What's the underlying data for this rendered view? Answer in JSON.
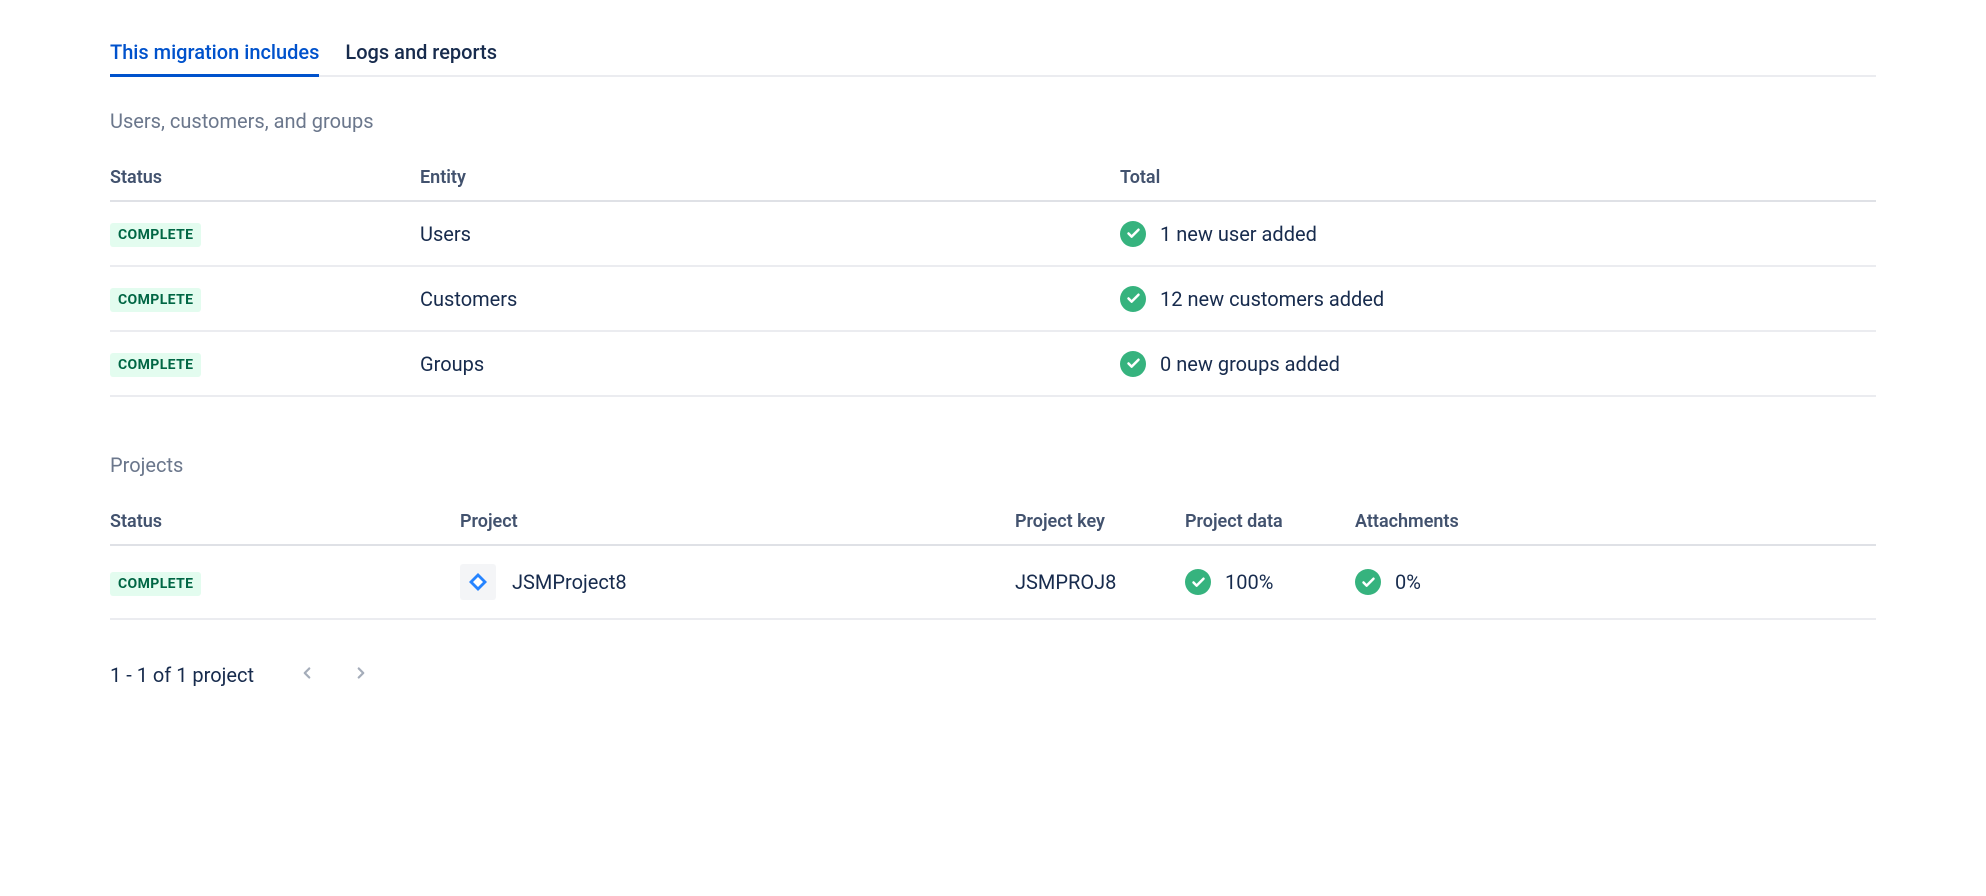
{
  "tabs": {
    "includes": "This migration includes",
    "logs": "Logs and reports"
  },
  "sections": {
    "users": {
      "title": "Users, customers, and groups",
      "headers": {
        "status": "Status",
        "entity": "Entity",
        "total": "Total"
      },
      "rows": [
        {
          "status": "COMPLETE",
          "entity": "Users",
          "total": "1 new user added"
        },
        {
          "status": "COMPLETE",
          "entity": "Customers",
          "total": "12 new customers added"
        },
        {
          "status": "COMPLETE",
          "entity": "Groups",
          "total": "0 new groups added"
        }
      ]
    },
    "projects": {
      "title": "Projects",
      "headers": {
        "status": "Status",
        "project": "Project",
        "key": "Project key",
        "data": "Project data",
        "attachments": "Attachments"
      },
      "rows": [
        {
          "status": "COMPLETE",
          "project": "JSMProject8",
          "key": "JSMPROJ8",
          "data": "100%",
          "attachments": "0%"
        }
      ]
    }
  },
  "pagination": {
    "info": "1 - 1 of 1 project"
  },
  "colors": {
    "accent": "#0052CC",
    "success": "#36B37E",
    "badge_bg": "#E3FCEF",
    "badge_text": "#006644"
  }
}
